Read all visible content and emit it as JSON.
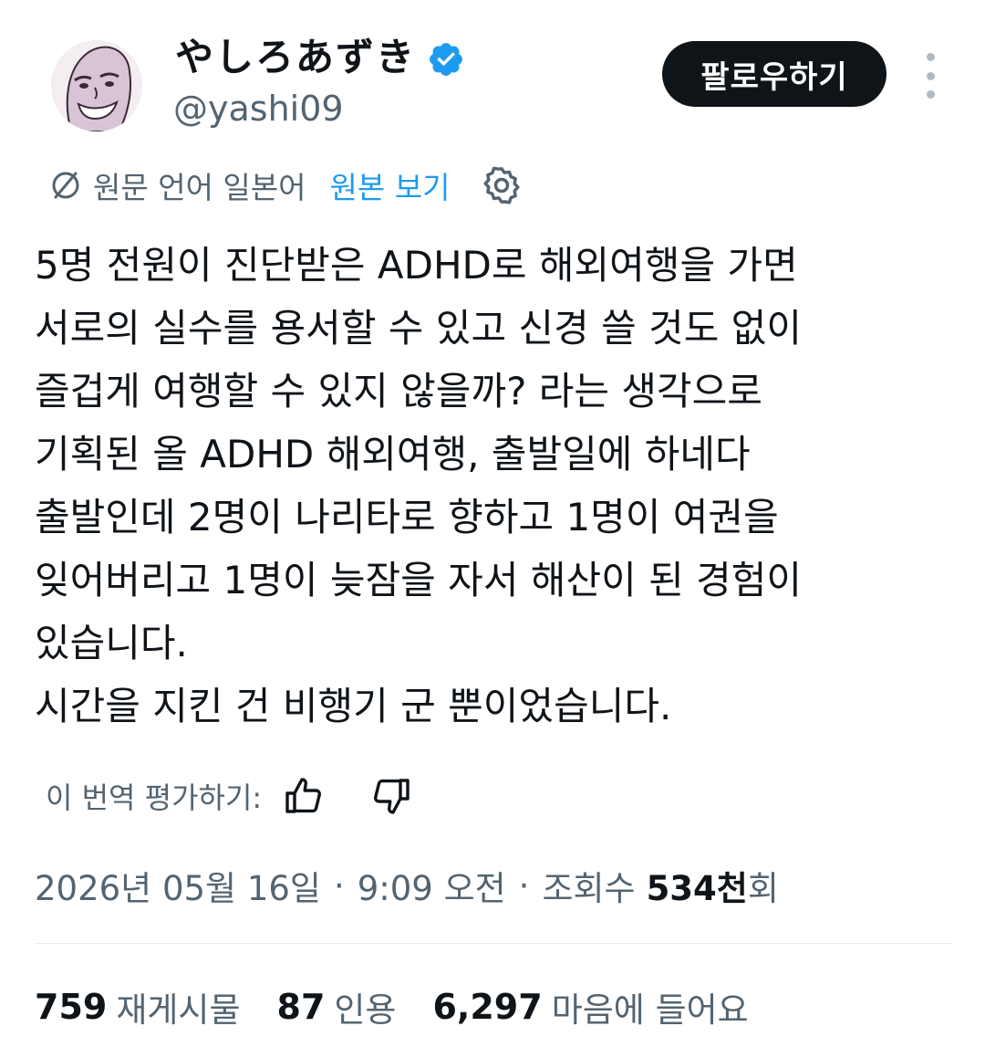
{
  "author": {
    "display_name": "やしろあずき",
    "handle": "@yashi09",
    "verified": true,
    "avatar": "cartoon-face-avatar"
  },
  "actions": {
    "follow_label": "팔로우하기",
    "more_icon": "more-vertical-icon"
  },
  "translation": {
    "translated_from": "원문 언어 일본어",
    "show_original": "원본 보기",
    "translate_icon": "translate-slash-icon",
    "settings_icon": "gear-icon"
  },
  "tweet": {
    "lines": [
      "5명 전원이 진단받은 ADHD로 해외여행을 가면",
      "서로의 실수를 용서할 수 있고 신경 쓸 것도 없이",
      "즐겁게 여행할 수 있지 않을까? 라는 생각으로",
      "기획된 올 ADHD 해외여행, 출발일에 하네다",
      "출발인데 2명이 나리타로 향하고 1명이 여권을",
      "잊어버리고 1명이 늦잠을 자서 해산이 된 경험이",
      "있습니다.",
      "시간을 지킨 건 비행기 군 뿐이었습니다."
    ]
  },
  "rating": {
    "label": "이 번역 평가하기:",
    "up_icon": "thumbs-up-icon",
    "down_icon": "thumbs-down-icon"
  },
  "meta": {
    "date": "2026년 05월 16일",
    "time": "9:09 오전",
    "separator": "·",
    "views_label": "조회수",
    "views_count": "534천",
    "views_suffix": "회"
  },
  "stats": [
    {
      "count": "759",
      "label": "재게시물"
    },
    {
      "count": "87",
      "label": "인용"
    },
    {
      "count": "6,297",
      "label": "마음에 들어요"
    }
  ],
  "colors": {
    "accent": "#1d9bf0",
    "text_primary": "#0f1419",
    "text_secondary": "#536471",
    "button_bg": "#0f1419",
    "divider": "#e6ecf0"
  }
}
